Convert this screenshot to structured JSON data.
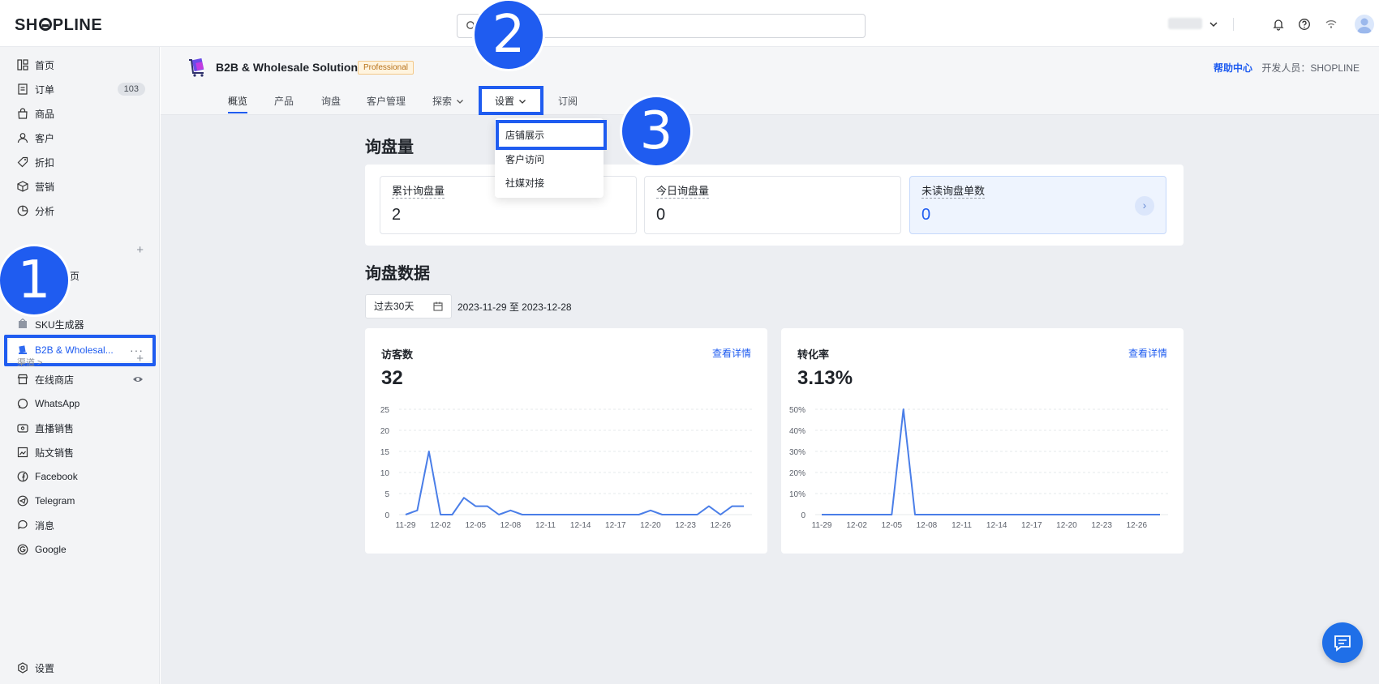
{
  "topbar": {
    "logo": "SHOPLINE",
    "search_placeholder": ""
  },
  "sidebar": {
    "items": [
      {
        "label": "首页",
        "icon": "dashboard-icon"
      },
      {
        "label": "订单",
        "icon": "order-icon",
        "badge": "103"
      },
      {
        "label": "商品",
        "icon": "bag-icon"
      },
      {
        "label": "客户",
        "icon": "user-icon"
      },
      {
        "label": "折扣",
        "icon": "tag-icon"
      },
      {
        "label": "营销",
        "icon": "box-icon"
      },
      {
        "label": "分析",
        "icon": "pie-icon"
      }
    ],
    "apps_partial_label": "页",
    "sku_label": "SKU生成器",
    "b2b_label": "B2B & Wholesal...",
    "more": "···",
    "channels_label": "渠道 >",
    "channels": [
      {
        "label": "在线商店",
        "icon": "store-icon"
      },
      {
        "label": "WhatsApp",
        "icon": "whatsapp-icon"
      },
      {
        "label": "直播销售",
        "icon": "live-icon"
      },
      {
        "label": "贴文销售",
        "icon": "post-icon"
      },
      {
        "label": "Facebook",
        "icon": "facebook-icon"
      },
      {
        "label": "Telegram",
        "icon": "telegram-icon"
      },
      {
        "label": "消息",
        "icon": "message-icon"
      },
      {
        "label": "Google",
        "icon": "google-icon"
      }
    ],
    "settings_label": "设置"
  },
  "app": {
    "title": "B2B & Wholesale Solution",
    "badge": "Professional",
    "help": "帮助中心",
    "developer": "开发人员：SHOPLINE",
    "tabs": [
      "概览",
      "产品",
      "询盘",
      "客户管理",
      "探索",
      "设置",
      "订阅"
    ],
    "dropdown": [
      "店铺展示",
      "客户访问",
      "社媒对接"
    ]
  },
  "callouts": [
    "1",
    "2",
    "3"
  ],
  "inquiry": {
    "heading": "询盘量",
    "cards": [
      {
        "label": "累计询盘量",
        "value": "2"
      },
      {
        "label": "今日询盘量",
        "value": "0"
      },
      {
        "label": "未读询盘单数",
        "value": "0"
      }
    ],
    "arrow": "›"
  },
  "data_section": {
    "heading": "询盘数据",
    "range_select": "过去30天",
    "range_text": "2023-11-29 至 2023-12-28"
  },
  "charts": {
    "visitors": {
      "title": "访客数",
      "link": "查看详情",
      "total": "32"
    },
    "conversion": {
      "title": "转化率",
      "link": "查看详情",
      "total": "3.13%"
    }
  },
  "chart_data": [
    {
      "type": "line",
      "title": "访客数",
      "x_ticks": [
        "11-29",
        "12-02",
        "12-05",
        "12-08",
        "12-11",
        "12-14",
        "12-17",
        "12-20",
        "12-23",
        "12-26"
      ],
      "y_ticks": [
        "25",
        "20",
        "15",
        "10",
        "5",
        "0"
      ],
      "ylim": [
        0,
        25
      ],
      "x": [
        "11-29",
        "11-30",
        "12-01",
        "12-02",
        "12-03",
        "12-04",
        "12-05",
        "12-06",
        "12-07",
        "12-08",
        "12-09",
        "12-10",
        "12-11",
        "12-12",
        "12-13",
        "12-14",
        "12-15",
        "12-16",
        "12-17",
        "12-18",
        "12-19",
        "12-20",
        "12-21",
        "12-22",
        "12-23",
        "12-24",
        "12-25",
        "12-26",
        "12-27",
        "12-28"
      ],
      "values": [
        0,
        1,
        15,
        0,
        0,
        4,
        2,
        2,
        0,
        1,
        0,
        0,
        0,
        0,
        0,
        0,
        0,
        0,
        0,
        0,
        0,
        1,
        0,
        0,
        0,
        0,
        2,
        0,
        2,
        2
      ],
      "color": "#4a7ee8"
    },
    {
      "type": "line",
      "title": "转化率",
      "x_ticks": [
        "11-29",
        "12-02",
        "12-05",
        "12-08",
        "12-11",
        "12-14",
        "12-17",
        "12-20",
        "12-23",
        "12-26"
      ],
      "y_ticks": [
        "50%",
        "40%",
        "30%",
        "20%",
        "10%",
        "0"
      ],
      "ylim": [
        0,
        50
      ],
      "x": [
        "11-29",
        "11-30",
        "12-01",
        "12-02",
        "12-03",
        "12-04",
        "12-05",
        "12-06",
        "12-07",
        "12-08",
        "12-09",
        "12-10",
        "12-11",
        "12-12",
        "12-13",
        "12-14",
        "12-15",
        "12-16",
        "12-17",
        "12-18",
        "12-19",
        "12-20",
        "12-21",
        "12-22",
        "12-23",
        "12-24",
        "12-25",
        "12-26",
        "12-27",
        "12-28"
      ],
      "values": [
        0,
        0,
        0,
        0,
        0,
        0,
        0,
        50,
        0,
        0,
        0,
        0,
        0,
        0,
        0,
        0,
        0,
        0,
        0,
        0,
        0,
        0,
        0,
        0,
        0,
        0,
        0,
        0,
        0,
        0
      ],
      "color": "#4a7ee8"
    }
  ],
  "colors": {
    "accent": "#1f5cf0",
    "line": "#4a7ee8",
    "badge_bg": "#fff4df"
  }
}
